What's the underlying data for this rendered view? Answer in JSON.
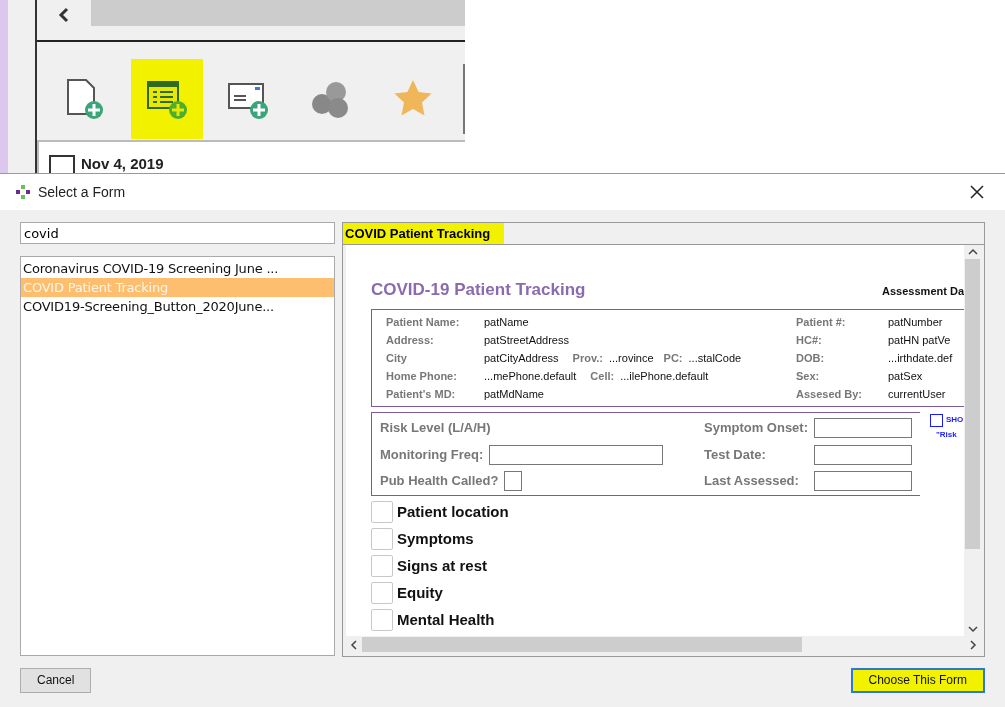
{
  "background_app": {
    "toolbar_buttons": [
      {
        "kind": "new-document",
        "highlighted": false
      },
      {
        "kind": "new-form",
        "highlighted": true
      },
      {
        "kind": "new-letter",
        "highlighted": false
      },
      {
        "kind": "pills",
        "highlighted": false
      },
      {
        "kind": "star",
        "highlighted": false
      }
    ],
    "date_heading": "Nov 4, 2019",
    "date_checked": false
  },
  "dialog": {
    "title": "Select a Form",
    "search": {
      "value": "covid"
    },
    "forms": [
      {
        "label": "Coronavirus COVID-19 Screening June ...",
        "selected": false
      },
      {
        "label": "COVID Patient Tracking",
        "selected": true
      },
      {
        "label": "COVID19-Screening_Button_2020June...",
        "selected": false
      }
    ],
    "preview": {
      "tab": "COVID Patient Tracking",
      "tab_highlighted": true,
      "form": {
        "title": "COVID-19 Patient Tracking",
        "assessment_label": "Assessment Da",
        "demographics": [
          {
            "fields": [
              {
                "label": "Patient Name:",
                "value": "patName"
              }
            ],
            "right": {
              "label": "Patient #:",
              "value": "patNumber"
            }
          },
          {
            "fields": [
              {
                "label": "Address:",
                "value": "patStreetAddress"
              }
            ],
            "right": {
              "label": "HC#:",
              "value": "patHN patVe"
            }
          },
          {
            "fields": [
              {
                "label": "City",
                "value": "patCityAddress"
              },
              {
                "label": "Prov.:",
                "value": "...rovince"
              },
              {
                "label": "PC:",
                "value": "...stalCode"
              }
            ],
            "right": {
              "label": "DOB:",
              "value": "...irthdate.def"
            }
          },
          {
            "fields": [
              {
                "label": "Home Phone:",
                "value": "...mePhone.default"
              },
              {
                "label": "Cell:",
                "value": "...ilePhone.default"
              }
            ],
            "right": {
              "label": "Sex:",
              "value": "patSex"
            }
          },
          {
            "fields": [
              {
                "label": "Patient's MD:",
                "value": "patMdName"
              }
            ],
            "right": {
              "label": "Assesed By:",
              "value": "currentUser"
            }
          }
        ],
        "risk": {
          "risk_level_label": "Risk Level (L/A/H)",
          "monitoring_label": "Monitoring Freq:",
          "pub_health_label": "Pub Health Called?",
          "pub_health_checked": false,
          "dates": [
            {
              "label": "Symptom Onset:"
            },
            {
              "label": "Test Date:"
            },
            {
              "label": "Last Assessed:"
            }
          ],
          "side_check": {
            "label": "SHO",
            "checked": false
          },
          "side_note": "\"Risk"
        },
        "sections": [
          {
            "label": "Patient location",
            "checked": false
          },
          {
            "label": "Symptoms",
            "checked": false
          },
          {
            "label": "Signs at rest",
            "checked": false
          },
          {
            "label": "Equity",
            "checked": false
          },
          {
            "label": "Mental Health",
            "checked": false
          }
        ]
      }
    },
    "buttons": [
      {
        "label": "Cancel",
        "kind": "cancel",
        "highlighted": false
      },
      {
        "label": "Choose This Form",
        "kind": "default",
        "highlighted": true
      }
    ]
  }
}
